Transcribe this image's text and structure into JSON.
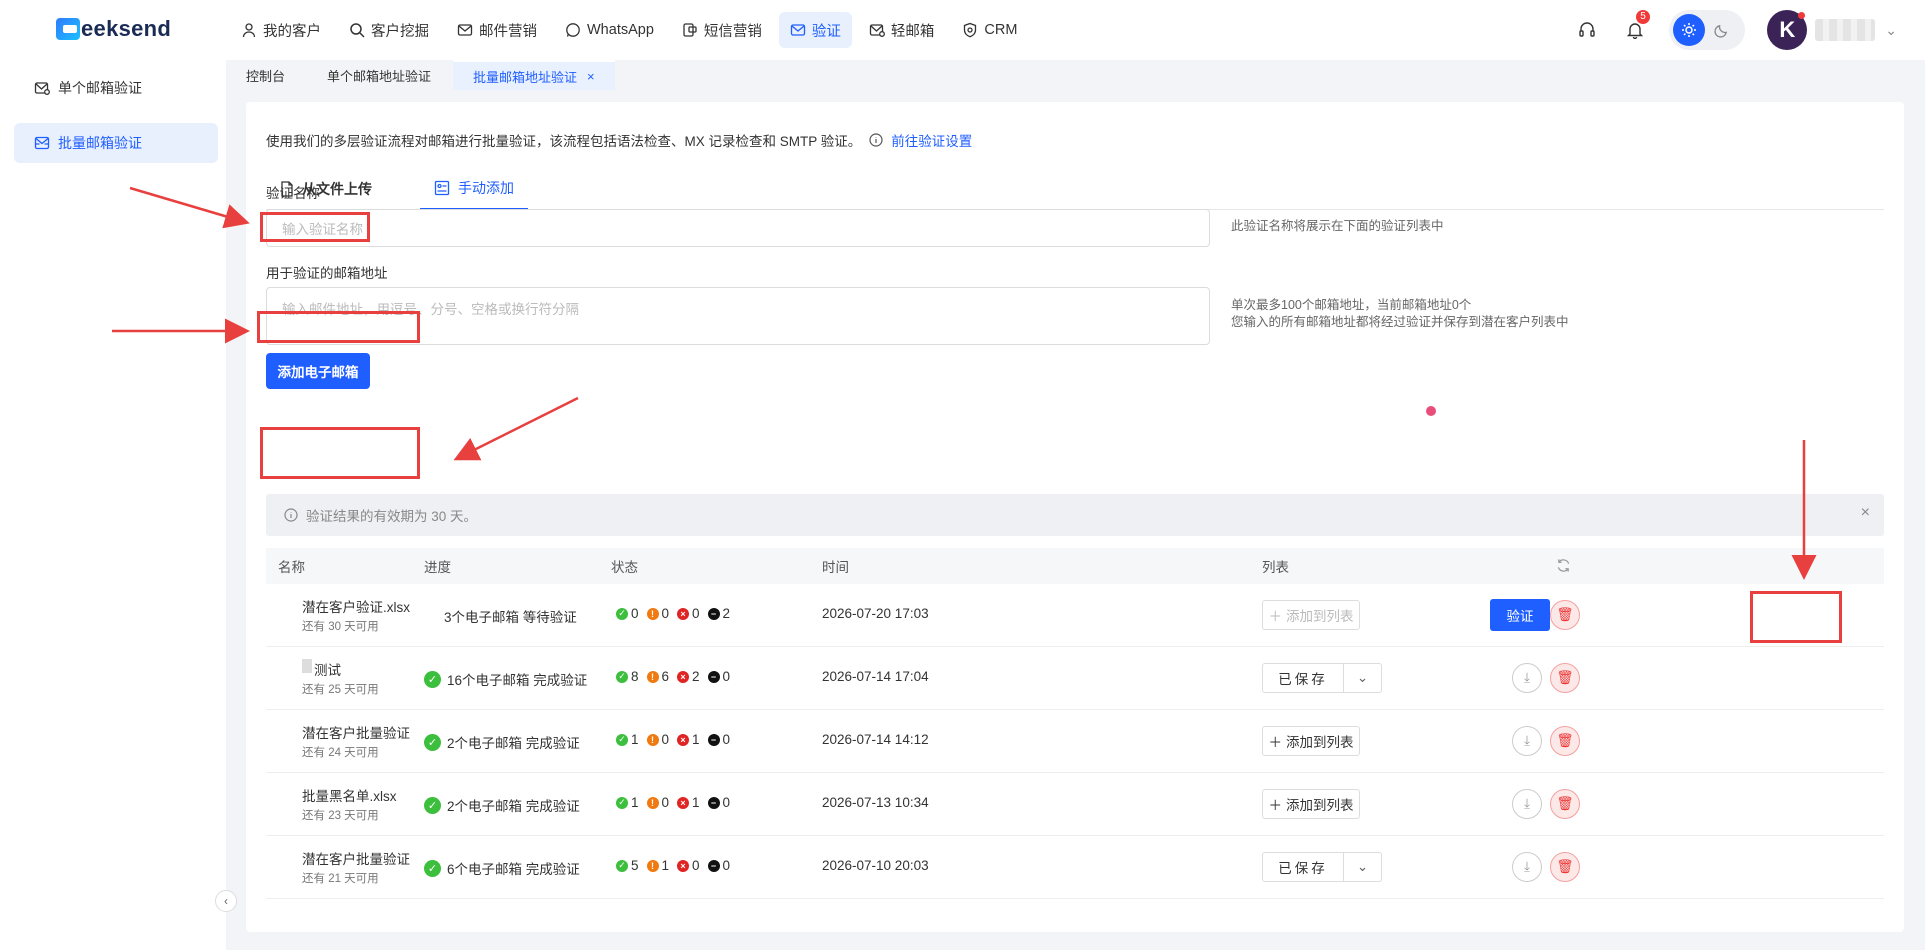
{
  "app": {
    "logo_text": "eeksend",
    "logo_letter": "G"
  },
  "nav": [
    {
      "label": "我的客户",
      "icon": "user-icon"
    },
    {
      "label": "客户挖掘",
      "icon": "search-icon"
    },
    {
      "label": "邮件营销",
      "icon": "mail-icon"
    },
    {
      "label": "WhatsApp",
      "icon": "whatsapp-icon"
    },
    {
      "label": "短信营销",
      "icon": "sms-icon"
    },
    {
      "label": "验证",
      "icon": "verify-mail-icon",
      "active": true
    },
    {
      "label": "轻邮箱",
      "icon": "light-mail-icon"
    },
    {
      "label": "CRM",
      "icon": "crm-icon"
    }
  ],
  "top_right": {
    "notification_count": "5",
    "avatar_letter": "K"
  },
  "page_tabs": [
    {
      "label": "控制台"
    },
    {
      "label": "单个邮箱地址验证"
    },
    {
      "label": "批量邮箱地址验证",
      "active": true,
      "close": "×"
    }
  ],
  "sidebar": [
    {
      "label": "单个邮箱验证",
      "icon": "mail-check-icon"
    },
    {
      "label": "批量邮箱验证",
      "icon": "mail-batch-icon",
      "active": true
    }
  ],
  "main": {
    "description": "使用我们的多层验证流程对邮箱进行批量验证，该流程包括语法检查、MX 记录检查和 SMTP 验证。",
    "settings_link": "前往验证设置",
    "mode_tabs": [
      {
        "label": "从文件上传",
        "icon": "file-icon"
      },
      {
        "label": "手动添加",
        "icon": "manual-add-icon",
        "active": true
      }
    ],
    "name_label": "验证名称",
    "name_placeholder": "输入验证名称",
    "name_hint": "此验证名称将展示在下面的验证列表中",
    "emails_label": "用于验证的邮箱地址",
    "emails_placeholder": "输入邮件地址，用逗号、分号、空格或换行符分隔",
    "emails_hint_1": "单次最多100个邮箱地址，当前邮箱地址0个",
    "emails_hint_2": "您输入的所有邮箱地址都将经过验证并保存到潜在客户列表中",
    "add_button": "添加电子邮箱",
    "notice": "验证结果的有效期为 30 天。",
    "notice_close": "×"
  },
  "table": {
    "headers": {
      "name": "名称",
      "progress": "进度",
      "status": "状态",
      "time": "时间",
      "list": "列表"
    },
    "rows": [
      {
        "name": "潜在客户验证.xlsx",
        "validity": "还有 30 天可用",
        "progress": "3个电子邮箱 等待验证",
        "done": false,
        "ok": "0",
        "warn": "0",
        "bad": "0",
        "unknown": "2",
        "time": "2026-07-20 17:03",
        "list_action": "添加到列表",
        "list_type": "add-disabled",
        "action": "验证"
      },
      {
        "name": "测试",
        "validity": "还有 25 天可用",
        "progress": "16个电子邮箱 完成验证",
        "done": true,
        "ok": "8",
        "warn": "6",
        "bad": "2",
        "unknown": "0",
        "time": "2026-07-14 17:04",
        "list_action": "已保存",
        "list_type": "saved"
      },
      {
        "name": "潜在客户批量验证",
        "validity": "还有 24 天可用",
        "progress": "2个电子邮箱 完成验证",
        "done": true,
        "ok": "1",
        "warn": "0",
        "bad": "1",
        "unknown": "0",
        "time": "2026-07-14 14:12",
        "list_action": "添加到列表",
        "list_type": "add"
      },
      {
        "name": "批量黑名单.xlsx",
        "validity": "还有 23 天可用",
        "progress": "2个电子邮箱 完成验证",
        "done": true,
        "ok": "1",
        "warn": "0",
        "bad": "1",
        "unknown": "0",
        "time": "2026-07-13 10:34",
        "list_action": "添加到列表",
        "list_type": "add"
      },
      {
        "name": "潜在客户批量验证",
        "validity": "还有 21 天可用",
        "progress": "6个电子邮箱 完成验证",
        "done": true,
        "ok": "5",
        "warn": "1",
        "bad": "0",
        "unknown": "0",
        "time": "2026-07-10 20:03",
        "list_action": "已保存",
        "list_type": "saved"
      }
    ]
  },
  "colors": {
    "accent": "#1f5eff",
    "annotation": "#e8403f",
    "ok": "#3cbf3c",
    "warn": "#f07a10",
    "bad": "#e02424",
    "unknown": "#111111"
  }
}
